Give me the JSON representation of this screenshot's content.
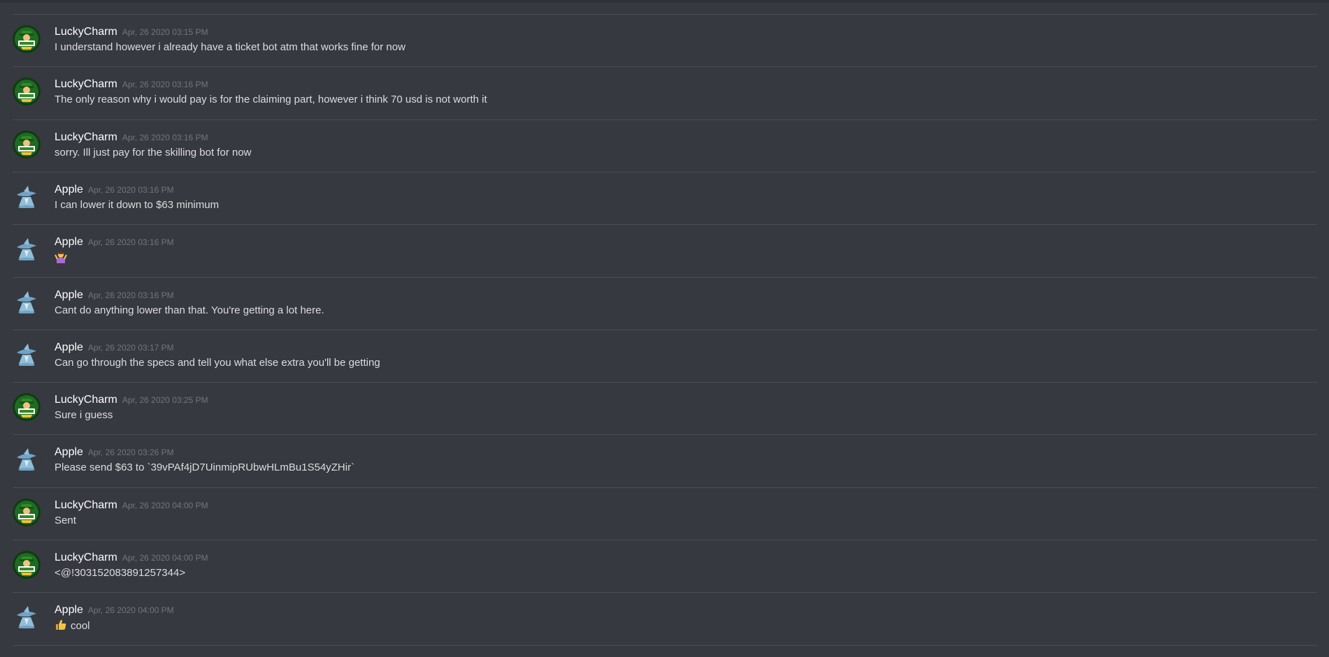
{
  "colors": {
    "background": "#36393f",
    "divider": "#4a4d53",
    "username": "#ffffff",
    "timestamp": "#72767d",
    "message_text": "#dcddde"
  },
  "messages": [
    {
      "author": "LuckyCharm",
      "avatar": "luckycharm-avatar",
      "timestamp": "Apr, 26 2020 03:15 PM",
      "text": "I understand however i already have a ticket bot atm that works fine for now"
    },
    {
      "author": "LuckyCharm",
      "avatar": "luckycharm-avatar",
      "timestamp": "Apr, 26 2020 03:16 PM",
      "text": "The only reason why i would pay is for the claiming part, however i think 70 usd is not worth it"
    },
    {
      "author": "LuckyCharm",
      "avatar": "luckycharm-avatar",
      "timestamp": "Apr, 26 2020 03:16 PM",
      "text": "sorry. Ill just pay for the skilling bot for now"
    },
    {
      "author": "Apple",
      "avatar": "apple-wizard-avatar",
      "timestamp": "Apr, 26 2020 03:16 PM",
      "text": "I can lower it down to $63 minimum"
    },
    {
      "author": "Apple",
      "avatar": "apple-wizard-avatar",
      "timestamp": "Apr, 26 2020 03:16 PM",
      "text": "",
      "emoji": "person-shrugging-emoji"
    },
    {
      "author": "Apple",
      "avatar": "apple-wizard-avatar",
      "timestamp": "Apr, 26 2020 03:16 PM",
      "text": "Cant do anything lower than that. You're getting a lot here."
    },
    {
      "author": "Apple",
      "avatar": "apple-wizard-avatar",
      "timestamp": "Apr, 26 2020 03:17 PM",
      "text": "Can go through the specs and tell you what else extra you'll be getting"
    },
    {
      "author": "LuckyCharm",
      "avatar": "luckycharm-avatar",
      "timestamp": "Apr, 26 2020 03:25 PM",
      "text": "Sure i guess"
    },
    {
      "author": "Apple",
      "avatar": "apple-wizard-avatar",
      "timestamp": "Apr, 26 2020 03:26 PM",
      "text": "Please send $63 to `39vPAf4jD7UinmipRUbwHLmBu1S54yZHir`"
    },
    {
      "author": "LuckyCharm",
      "avatar": "luckycharm-avatar",
      "timestamp": "Apr, 26 2020 04:00 PM",
      "text": "Sent"
    },
    {
      "author": "LuckyCharm",
      "avatar": "luckycharm-avatar",
      "timestamp": "Apr, 26 2020 04:00 PM",
      "text": "<@!303152083891257344>"
    },
    {
      "author": "Apple",
      "avatar": "apple-wizard-avatar",
      "timestamp": "Apr, 26 2020 04:00 PM",
      "text": "cool",
      "emoji": "thumbs-up-emoji"
    }
  ]
}
